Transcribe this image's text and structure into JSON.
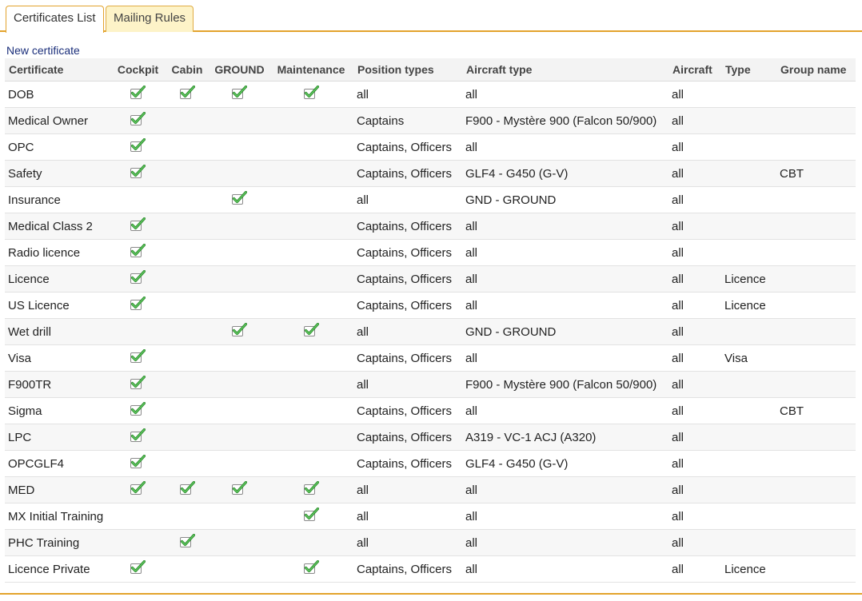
{
  "tabs": [
    {
      "label": "Certificates List",
      "active": true
    },
    {
      "label": "Mailing Rules",
      "active": false
    }
  ],
  "new_certificate_link": "New certificate",
  "accent_color": "#e3a32c",
  "check_icon": "green-checkmark-icon",
  "table": {
    "columns": [
      "Certificate",
      "Cockpit",
      "Cabin",
      "GROUND",
      "Maintenance",
      "Position types",
      "Aircraft type",
      "Aircraft",
      "Type",
      "Group name"
    ],
    "rows": [
      {
        "certificate": "DOB",
        "cockpit": true,
        "cabin": true,
        "ground": true,
        "maintenance": true,
        "position_types": "all",
        "aircraft_type": "all",
        "aircraft": "all",
        "type": "",
        "group_name": ""
      },
      {
        "certificate": "Medical Owner",
        "cockpit": true,
        "cabin": false,
        "ground": false,
        "maintenance": false,
        "position_types": "Captains",
        "aircraft_type": "F900 - Mystère 900 (Falcon 50/900)",
        "aircraft": "all",
        "type": "",
        "group_name": ""
      },
      {
        "certificate": "OPC",
        "cockpit": true,
        "cabin": false,
        "ground": false,
        "maintenance": false,
        "position_types": "Captains, Officers",
        "aircraft_type": "all",
        "aircraft": "all",
        "type": "",
        "group_name": ""
      },
      {
        "certificate": "Safety",
        "cockpit": true,
        "cabin": false,
        "ground": false,
        "maintenance": false,
        "position_types": "Captains, Officers",
        "aircraft_type": "GLF4 - G450 (G-V)",
        "aircraft": "all",
        "type": "",
        "group_name": "CBT"
      },
      {
        "certificate": "Insurance",
        "cockpit": false,
        "cabin": false,
        "ground": true,
        "maintenance": false,
        "position_types": "all",
        "aircraft_type": "GND - GROUND",
        "aircraft": "all",
        "type": "",
        "group_name": ""
      },
      {
        "certificate": "Medical Class 2",
        "cockpit": true,
        "cabin": false,
        "ground": false,
        "maintenance": false,
        "position_types": "Captains, Officers",
        "aircraft_type": "all",
        "aircraft": "all",
        "type": "",
        "group_name": ""
      },
      {
        "certificate": "Radio licence",
        "cockpit": true,
        "cabin": false,
        "ground": false,
        "maintenance": false,
        "position_types": "Captains, Officers",
        "aircraft_type": "all",
        "aircraft": "all",
        "type": "",
        "group_name": ""
      },
      {
        "certificate": "Licence",
        "cockpit": true,
        "cabin": false,
        "ground": false,
        "maintenance": false,
        "position_types": "Captains, Officers",
        "aircraft_type": "all",
        "aircraft": "all",
        "type": "Licence",
        "group_name": ""
      },
      {
        "certificate": "US Licence",
        "cockpit": true,
        "cabin": false,
        "ground": false,
        "maintenance": false,
        "position_types": "Captains, Officers",
        "aircraft_type": "all",
        "aircraft": "all",
        "type": "Licence",
        "group_name": ""
      },
      {
        "certificate": "Wet drill",
        "cockpit": false,
        "cabin": false,
        "ground": true,
        "maintenance": true,
        "position_types": "all",
        "aircraft_type": "GND - GROUND",
        "aircraft": "all",
        "type": "",
        "group_name": ""
      },
      {
        "certificate": "Visa",
        "cockpit": true,
        "cabin": false,
        "ground": false,
        "maintenance": false,
        "position_types": "Captains, Officers",
        "aircraft_type": "all",
        "aircraft": "all",
        "type": "Visa",
        "group_name": ""
      },
      {
        "certificate": "F900TR",
        "cockpit": true,
        "cabin": false,
        "ground": false,
        "maintenance": false,
        "position_types": "all",
        "aircraft_type": "F900 - Mystère 900 (Falcon 50/900)",
        "aircraft": "all",
        "type": "",
        "group_name": ""
      },
      {
        "certificate": "Sigma",
        "cockpit": true,
        "cabin": false,
        "ground": false,
        "maintenance": false,
        "position_types": "Captains, Officers",
        "aircraft_type": "all",
        "aircraft": "all",
        "type": "",
        "group_name": "CBT"
      },
      {
        "certificate": "LPC",
        "cockpit": true,
        "cabin": false,
        "ground": false,
        "maintenance": false,
        "position_types": "Captains, Officers",
        "aircraft_type": "A319 - VC-1 ACJ (A320)",
        "aircraft": "all",
        "type": "",
        "group_name": ""
      },
      {
        "certificate": "OPCGLF4",
        "cockpit": true,
        "cabin": false,
        "ground": false,
        "maintenance": false,
        "position_types": "Captains, Officers",
        "aircraft_type": "GLF4 - G450 (G-V)",
        "aircraft": "all",
        "type": "",
        "group_name": ""
      },
      {
        "certificate": "MED",
        "cockpit": true,
        "cabin": true,
        "ground": true,
        "maintenance": true,
        "position_types": "all",
        "aircraft_type": "all",
        "aircraft": "all",
        "type": "",
        "group_name": ""
      },
      {
        "certificate": "MX Initial Training",
        "cockpit": false,
        "cabin": false,
        "ground": false,
        "maintenance": true,
        "position_types": "all",
        "aircraft_type": "all",
        "aircraft": "all",
        "type": "",
        "group_name": ""
      },
      {
        "certificate": "PHC Training",
        "cockpit": false,
        "cabin": true,
        "ground": false,
        "maintenance": false,
        "position_types": "all",
        "aircraft_type": "all",
        "aircraft": "all",
        "type": "",
        "group_name": ""
      },
      {
        "certificate": "Licence Private",
        "cockpit": true,
        "cabin": false,
        "ground": false,
        "maintenance": true,
        "position_types": "Captains, Officers",
        "aircraft_type": "all",
        "aircraft": "all",
        "type": "Licence",
        "group_name": ""
      }
    ]
  }
}
